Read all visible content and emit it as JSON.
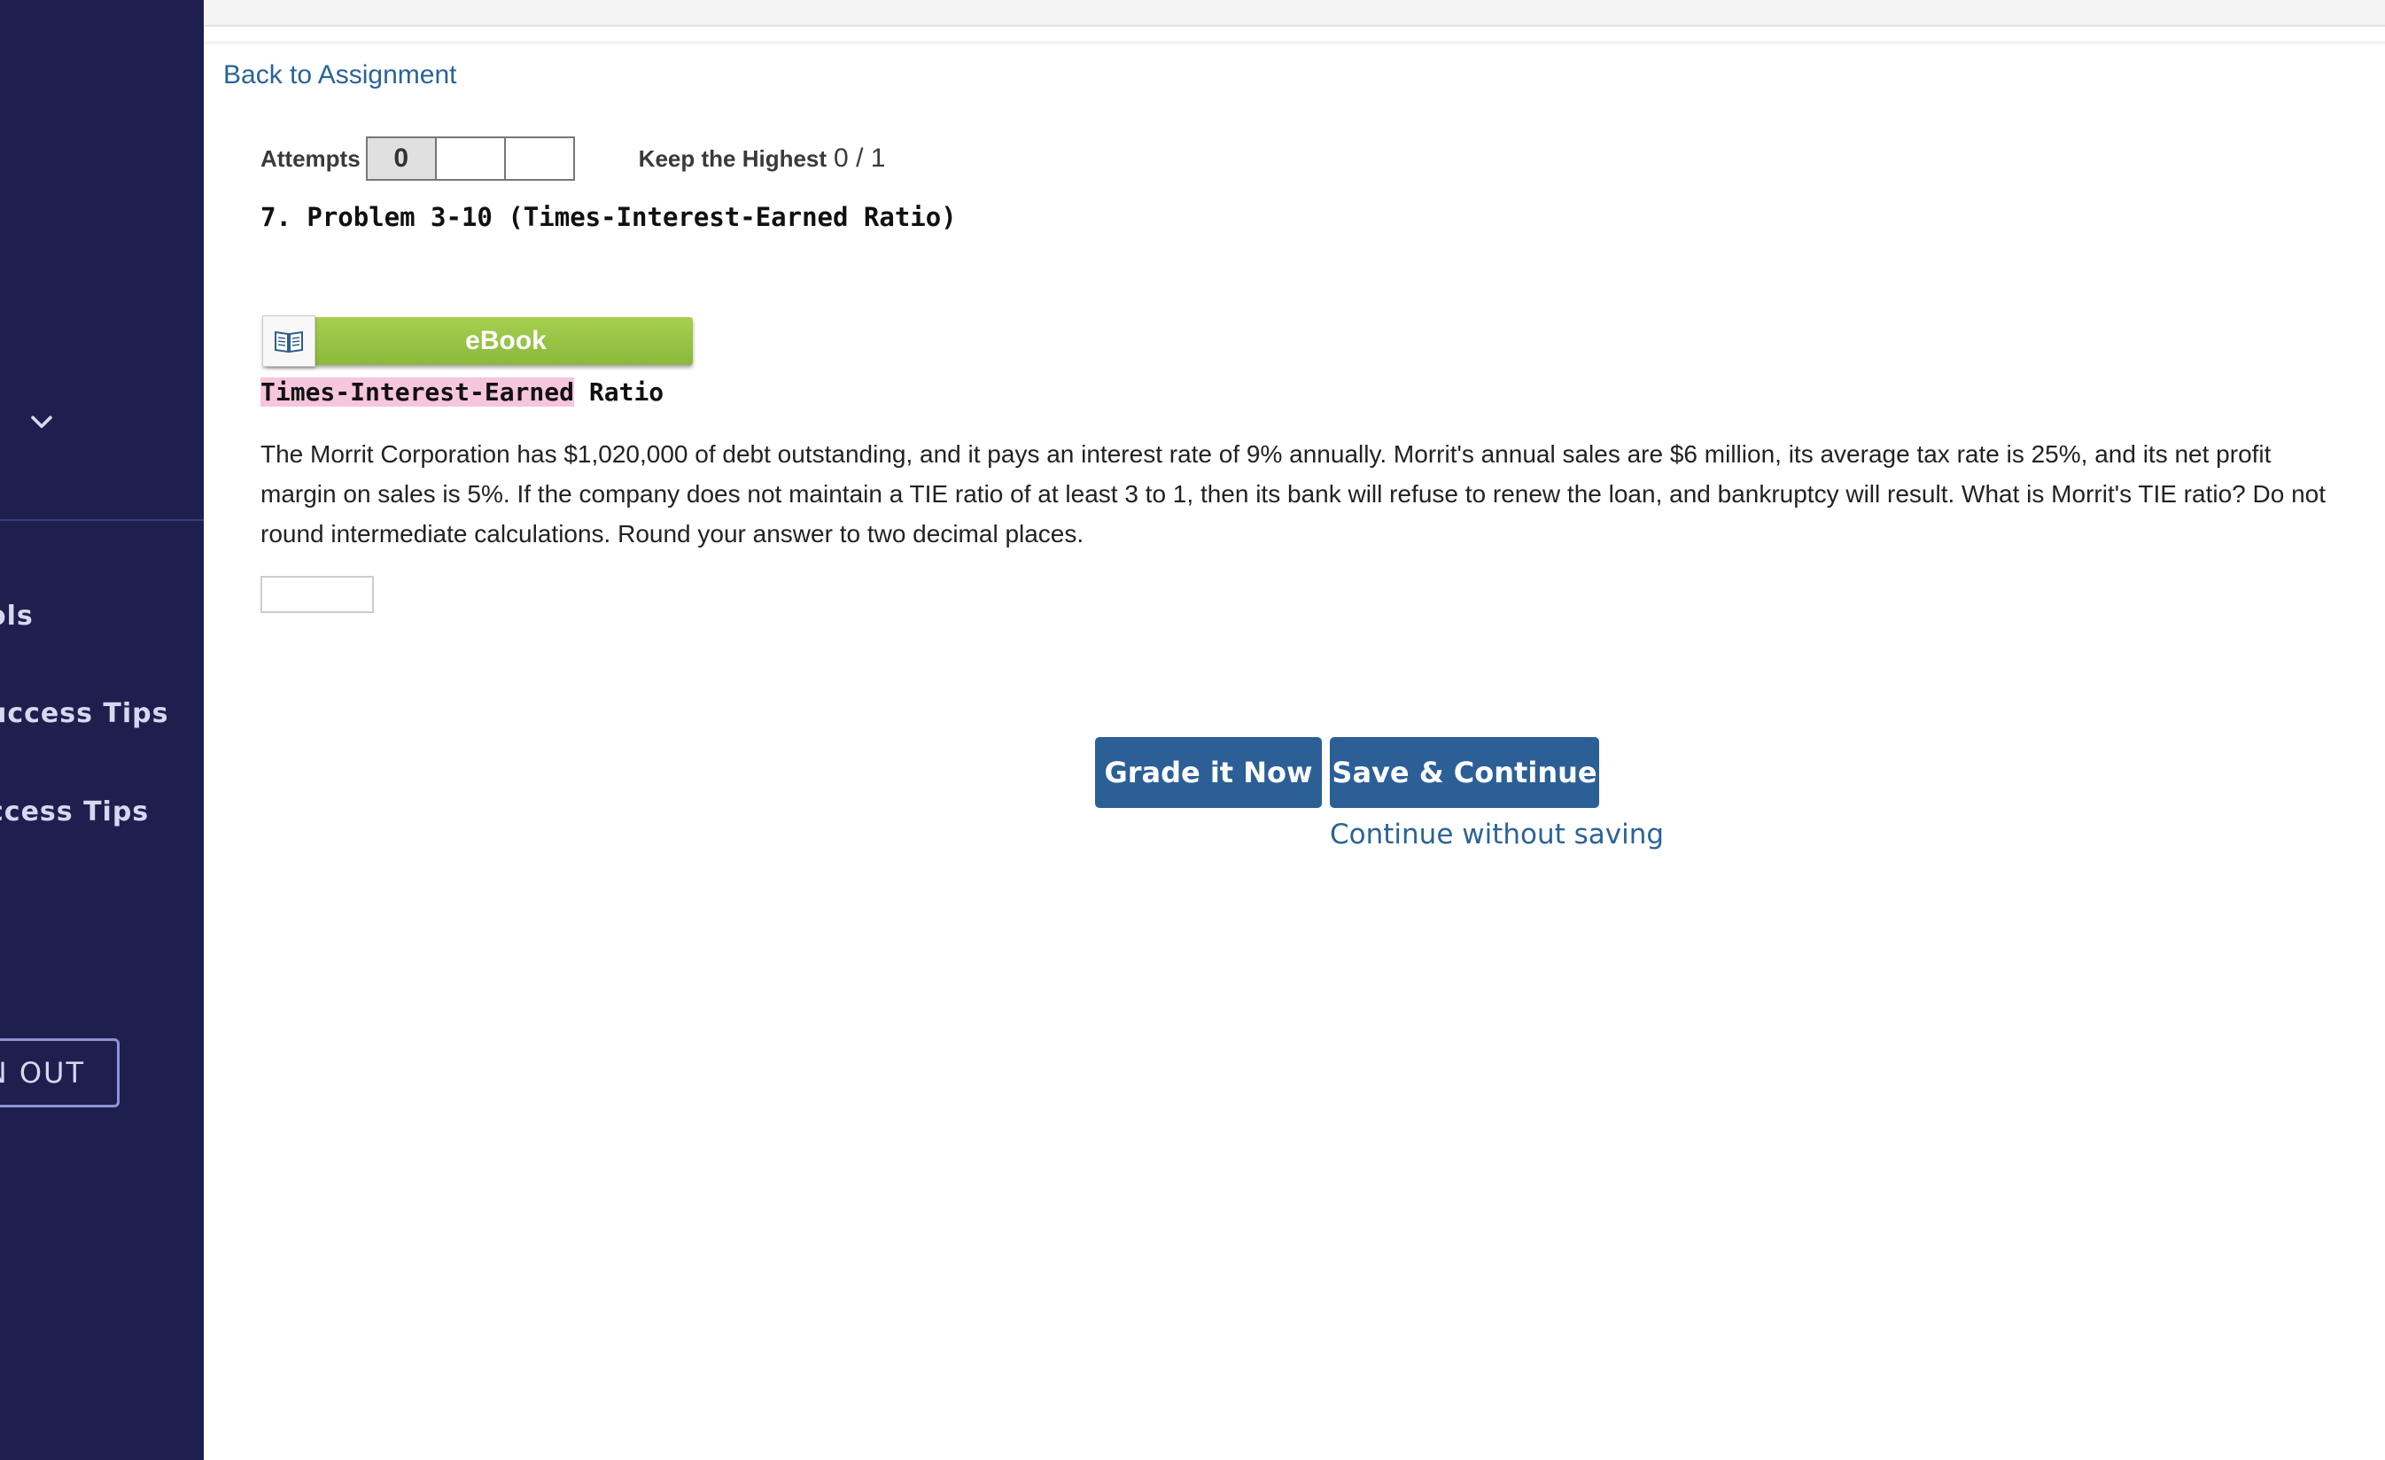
{
  "sidebar": {
    "items": [
      {
        "label": "ols"
      },
      {
        "label": "uccess Tips"
      },
      {
        "label": "ccess Tips"
      }
    ],
    "signout_label": "N OUT"
  },
  "nav": {
    "back_link": "Back to Assignment"
  },
  "attempts": {
    "label": "Attempts",
    "boxes": [
      "0",
      "",
      ""
    ],
    "keep_label": "Keep the Highest",
    "score": "0 / 1"
  },
  "problem": {
    "title": "7.  Problem 3-10 (Times-Interest-Earned Ratio)",
    "ebook_label": "eBook",
    "section_highlight": "Times-Interest-Earned",
    "section_rest": " Ratio",
    "text": "The Morrit Corporation has $1,020,000 of debt outstanding, and it pays an interest rate of 9% annually. Morrit's annual sales are $6 million, its average tax rate is 25%, and its net profit margin on sales is 5%. If the company does not maintain a TIE ratio of at least 3 to 1, then its bank will refuse to renew the loan, and bankruptcy will result. What is Morrit's TIE ratio? Do not round intermediate calculations. Round your answer to two decimal places.",
    "answer_value": ""
  },
  "actions": {
    "grade_label": "Grade it Now",
    "save_label": "Save & Continue",
    "continue_label": "Continue without saving"
  },
  "colors": {
    "sidebar_bg": "#1e1f4f",
    "primary_button": "#2b5f96",
    "link": "#2a6496",
    "ebook_green": "#8bb83c",
    "highlight": "#f6c6dd"
  }
}
